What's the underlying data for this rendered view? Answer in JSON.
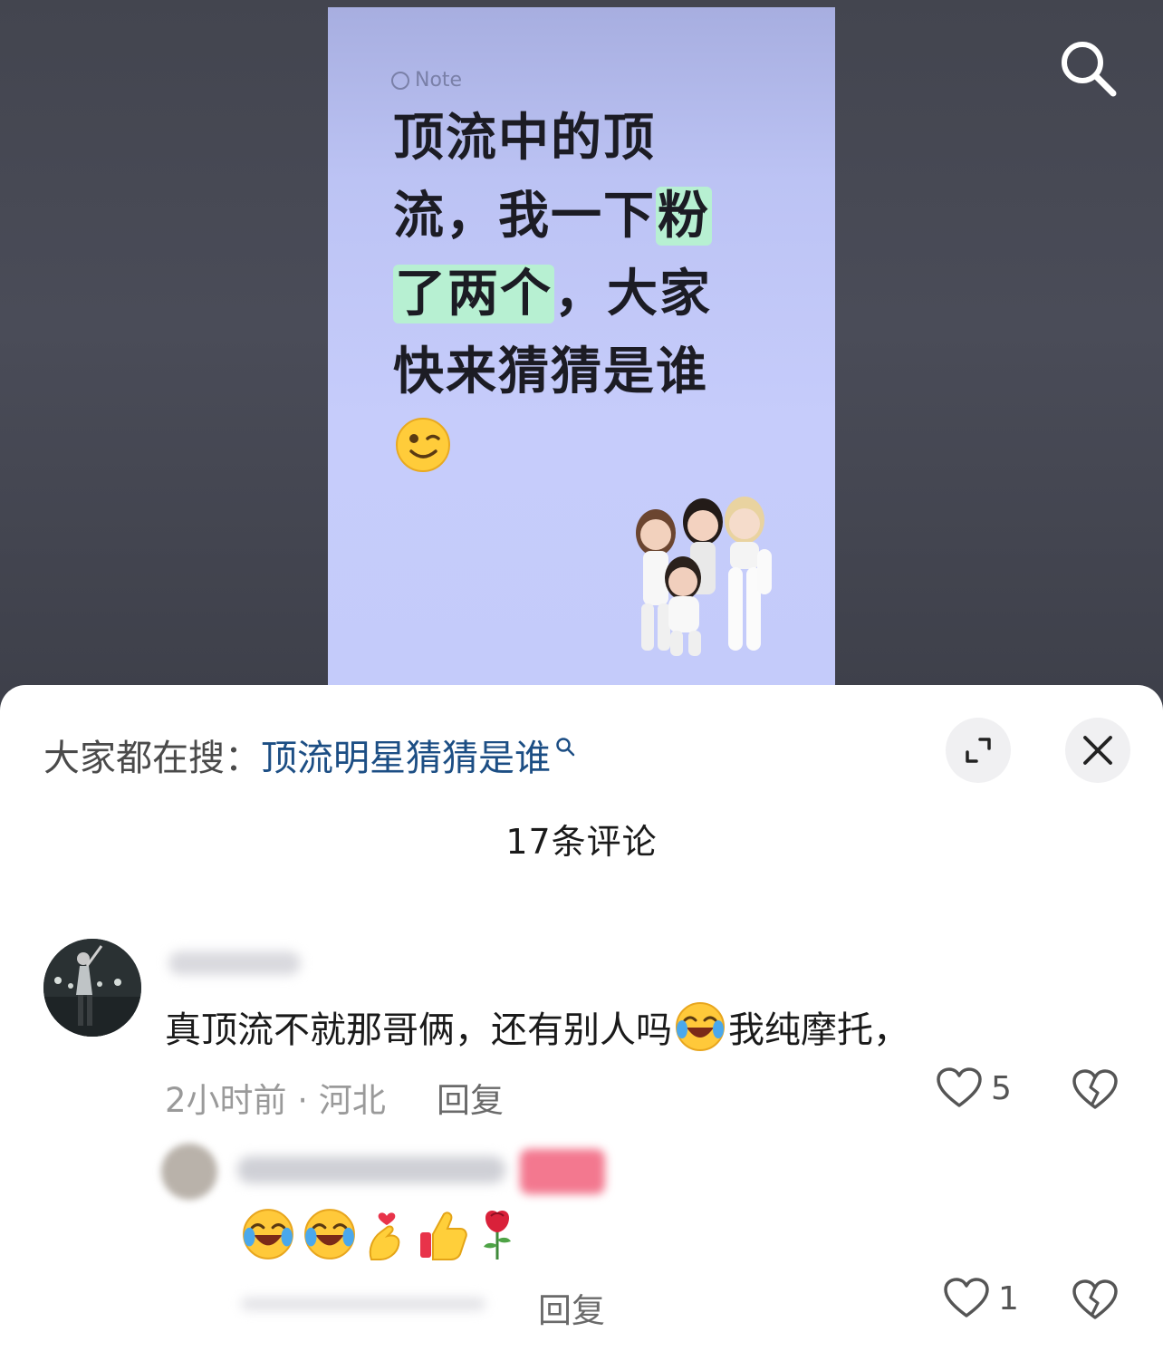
{
  "note": {
    "tag": "Note",
    "lines": [
      "顶流中的顶",
      "流，我一下",
      "粉",
      "了两个",
      "，大家",
      "快来猜猜是谁"
    ]
  },
  "sheet": {
    "hot_search_prefix": "大家都在搜：",
    "hot_search_query": "顶流明星猜猜是谁",
    "comment_count": "17条评论"
  },
  "comments": [
    {
      "text_before": "真顶流不就那哥俩，还有别人吗",
      "text_after": "我纯摩托，",
      "meta": "2小时前 · 河北",
      "reply_label": "回复",
      "likes": "5"
    },
    {
      "reply_label": "回复",
      "likes": "1"
    }
  ],
  "icons": {
    "search": "search-icon",
    "expand": "expand-icon",
    "close": "close-icon",
    "like": "heart-icon",
    "dislike": "broken-heart-icon"
  },
  "colors": {
    "link": "#1c4e84",
    "highlight": "#b7f0d2",
    "card_bg": "#c6ccfb"
  }
}
